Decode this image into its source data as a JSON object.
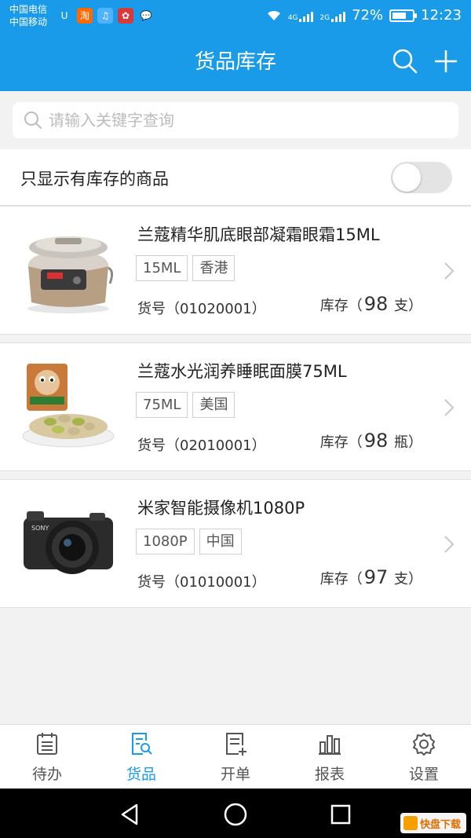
{
  "status_bar": {
    "carrier_1": "中国电信",
    "carrier_2": "中国移动",
    "network_1": "4G",
    "network_2": "2G",
    "battery": "72%",
    "battery_level": 0.72,
    "time": "12:23",
    "app_icons": [
      {
        "name": "shield-app-icon",
        "glyph": "U",
        "color": "#1a9bea"
      },
      {
        "name": "taobao-icon",
        "glyph": "淘",
        "color": "#ff6a00"
      },
      {
        "name": "music-icon",
        "glyph": "♫",
        "color": "#4fb3ff"
      },
      {
        "name": "huawei-icon",
        "glyph": "✿",
        "color": "#d63a3a"
      },
      {
        "name": "chat-icon",
        "glyph": "💬",
        "color": "#1a9bea"
      }
    ]
  },
  "header": {
    "title": "货品库存",
    "search_icon": "search-icon",
    "add_icon": "plus-icon"
  },
  "search": {
    "placeholder": "请输入关键字查询",
    "value": ""
  },
  "filter": {
    "label": "只显示有库存的商品",
    "toggle_on": false
  },
  "products": [
    {
      "name": "兰蔻精华肌底眼部凝霜眼霜15ML",
      "tags": [
        "15ML",
        "香港"
      ],
      "code": "货号（01020001）",
      "stock_prefix": "库存（",
      "stock_value": "98",
      "stock_suffix": " 支）",
      "image": "rice-cooker-image"
    },
    {
      "name": "兰蔻水光润养睡眠面膜75ML",
      "tags": [
        "75ML",
        "美国"
      ],
      "code": "货号（02010001）",
      "stock_prefix": "库存（",
      "stock_value": "98",
      "stock_suffix": " 瓶）",
      "image": "pistachio-image"
    },
    {
      "name": "米家智能摄像机1080P",
      "tags": [
        "1080P",
        "中国"
      ],
      "code": "货号（01010001）",
      "stock_prefix": "库存（",
      "stock_value": "97",
      "stock_suffix": " 支）",
      "image": "camera-image"
    }
  ],
  "bottom_nav": [
    {
      "label": "待办",
      "icon": "todo-calendar-icon",
      "active": false
    },
    {
      "label": "货品",
      "icon": "goods-search-icon",
      "active": true
    },
    {
      "label": "开单",
      "icon": "new-order-icon",
      "active": false
    },
    {
      "label": "报表",
      "icon": "bar-chart-icon",
      "active": false
    },
    {
      "label": "设置",
      "icon": "gear-icon",
      "active": false
    }
  ],
  "system_nav": [
    "back-icon",
    "home-icon",
    "recents-icon"
  ],
  "watermark": {
    "text": "快盘下载"
  },
  "colors": {
    "primary": "#1a9bea",
    "background": "#f2f2f2",
    "card": "#ffffff",
    "tag_border": "#d0d0d0"
  }
}
